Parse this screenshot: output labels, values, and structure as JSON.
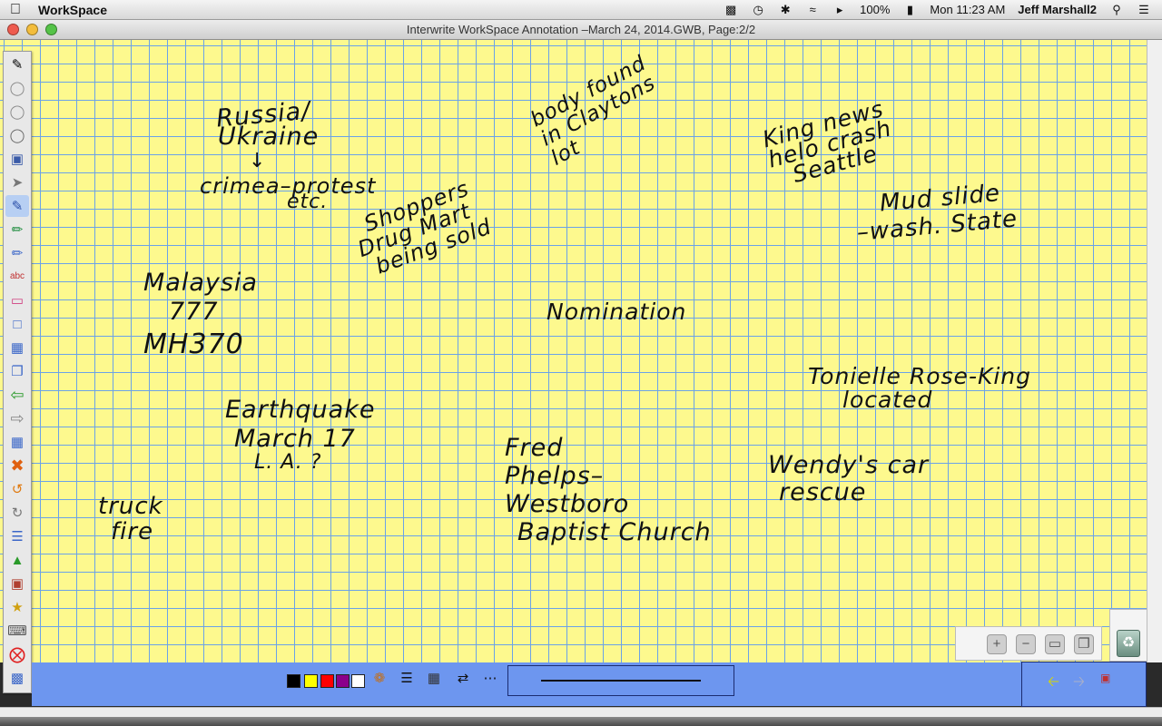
{
  "menubar": {
    "app_name": "WorkSpace",
    "battery": "100%",
    "clock": "Mon 11:23 AM",
    "user": "Jeff Marshall2",
    "icons": [
      "apple-icon",
      "app-icon",
      "time-machine-icon",
      "bluetooth-icon",
      "wifi-icon",
      "volume-icon",
      "battery-icon",
      "spotlight-icon",
      "notification-icon"
    ]
  },
  "window": {
    "title": "Interwrite WorkSpace Annotation –March 24, 2014.GWB, Page:2/2"
  },
  "notes": [
    {
      "id": "russia",
      "lines": [
        "Russia/",
        "Ukraine",
        "↓",
        "crimea–protest",
        "etc."
      ]
    },
    {
      "id": "body",
      "lines": [
        "body found",
        "in Claytons",
        "lot"
      ]
    },
    {
      "id": "king",
      "lines": [
        "King news",
        "helo crash",
        "Seattle"
      ]
    },
    {
      "id": "shoppers",
      "lines": [
        "Shoppers",
        "Drug Mart",
        "being sold"
      ]
    },
    {
      "id": "mudslide",
      "lines": [
        "Mud slide",
        "–wash. State"
      ]
    },
    {
      "id": "malaysia",
      "lines": [
        "Malaysia",
        "777",
        "MH370"
      ]
    },
    {
      "id": "nomination",
      "lines": [
        "Nomination"
      ]
    },
    {
      "id": "tonielle",
      "lines": [
        "Tonielle Rose-King",
        "located"
      ]
    },
    {
      "id": "earthquake",
      "lines": [
        "Earthquake",
        "March 17",
        "L. A. ?"
      ]
    },
    {
      "id": "fred",
      "lines": [
        "Fred",
        "Phelps–",
        "Westboro",
        "Baptist Church"
      ]
    },
    {
      "id": "wendys",
      "lines": [
        "Wendy's car",
        "rescue"
      ]
    },
    {
      "id": "truck",
      "lines": [
        "truck",
        "fire"
      ]
    }
  ],
  "colors": {
    "paper": "#fdf98e",
    "grid": "#6ba2e8",
    "ribbon": "#6d96ef",
    "swatches": [
      "#000000",
      "#ffff00",
      "#ff0000",
      "#8b008b",
      "#ffffff"
    ]
  }
}
